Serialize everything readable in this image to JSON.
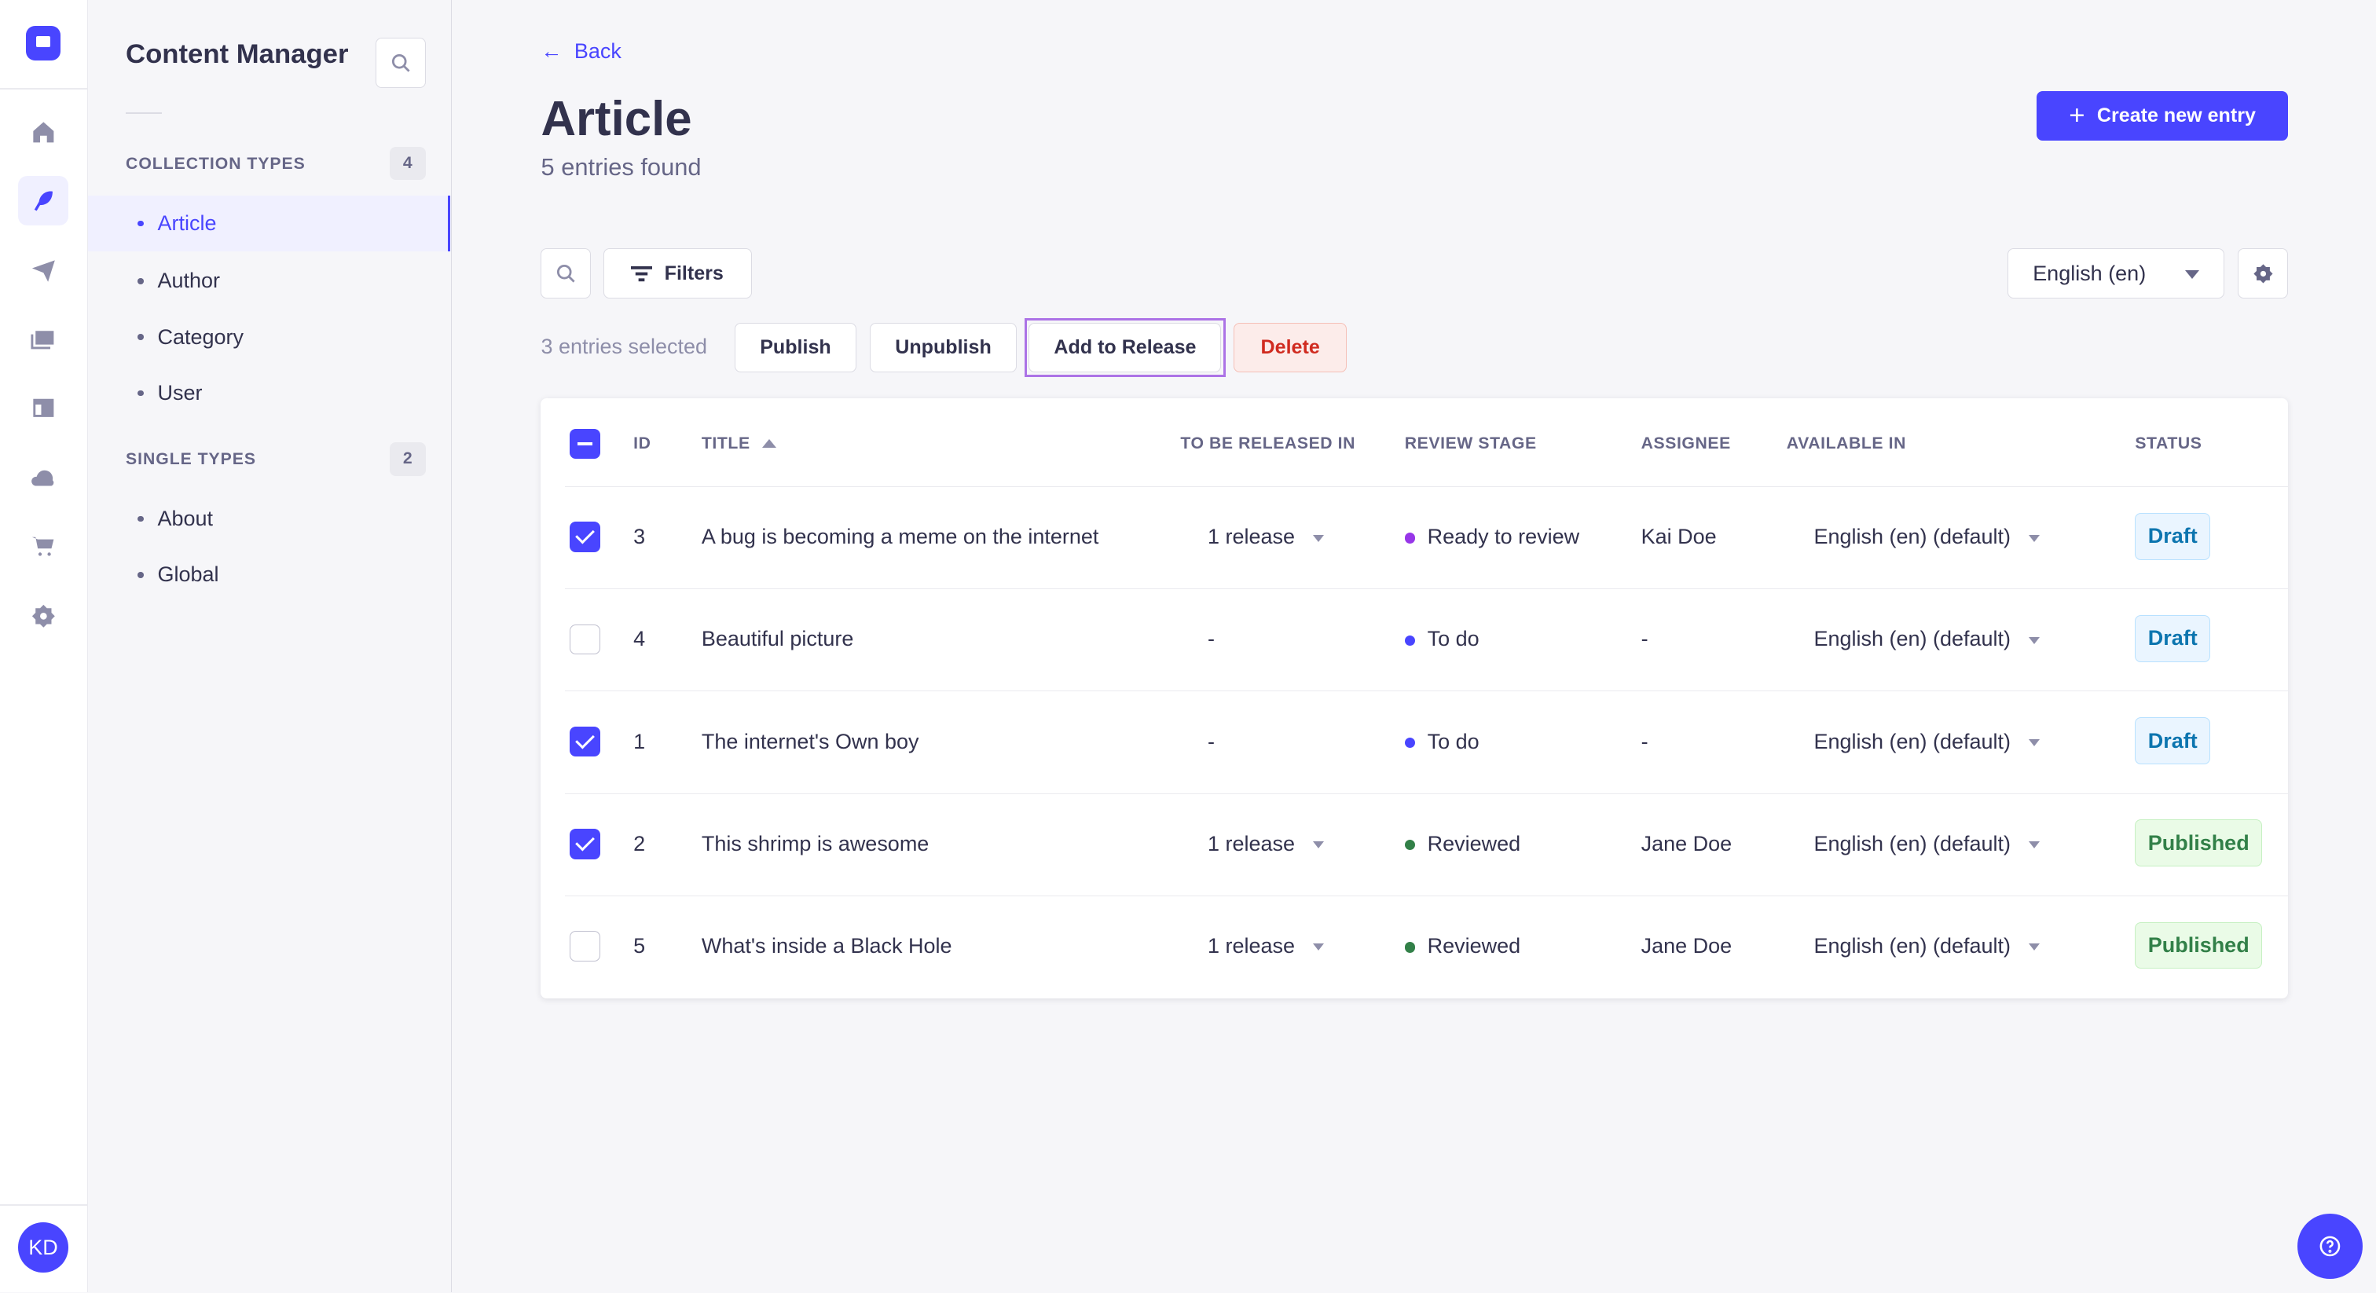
{
  "user_initials": "KD",
  "sidebar": {
    "title": "Content Manager",
    "collection_types_label": "COLLECTION TYPES",
    "collection_count": "4",
    "collection_items": [
      "Article",
      "Author",
      "Category",
      "User"
    ],
    "single_types_label": "SINGLE TYPES",
    "single_count": "2",
    "single_items": [
      "About",
      "Global"
    ]
  },
  "header": {
    "back": "Back",
    "title": "Article",
    "subtitle": "5 entries found",
    "create_button": "Create new entry"
  },
  "toolbar": {
    "filters": "Filters",
    "locale": "English (en)"
  },
  "bulk": {
    "selected_text": "3 entries selected",
    "publish": "Publish",
    "unpublish": "Unpublish",
    "add_to_release": "Add to Release",
    "delete": "Delete"
  },
  "table": {
    "headers": {
      "id": "ID",
      "title": "TITLE",
      "release": "TO BE RELEASED IN",
      "review": "REVIEW STAGE",
      "assignee": "ASSIGNEE",
      "available": "AVAILABLE IN",
      "status": "STATUS"
    },
    "rows": [
      {
        "checked": true,
        "id": "3",
        "title": "A bug is becoming a meme on the internet",
        "release": "1 release",
        "review": "Ready to review",
        "review_color": "#9736e8",
        "assignee": "Kai Doe",
        "available": "English (en) (default)",
        "status": "Draft"
      },
      {
        "checked": false,
        "id": "4",
        "title": "Beautiful picture",
        "release": "-",
        "review": "To do",
        "review_color": "#4945ff",
        "assignee": "-",
        "available": "English (en) (default)",
        "status": "Draft"
      },
      {
        "checked": true,
        "id": "1",
        "title": "The internet's Own boy",
        "release": "-",
        "review": "To do",
        "review_color": "#4945ff",
        "assignee": "-",
        "available": "English (en) (default)",
        "status": "Draft"
      },
      {
        "checked": true,
        "id": "2",
        "title": "This shrimp is awesome",
        "release": "1 release",
        "review": "Reviewed",
        "review_color": "#328048",
        "assignee": "Jane Doe",
        "available": "English (en) (default)",
        "status": "Published"
      },
      {
        "checked": false,
        "id": "5",
        "title": "What's inside a Black Hole",
        "release": "1 release",
        "review": "Reviewed",
        "review_color": "#328048",
        "assignee": "Jane Doe",
        "available": "English (en) (default)",
        "status": "Published"
      }
    ]
  }
}
